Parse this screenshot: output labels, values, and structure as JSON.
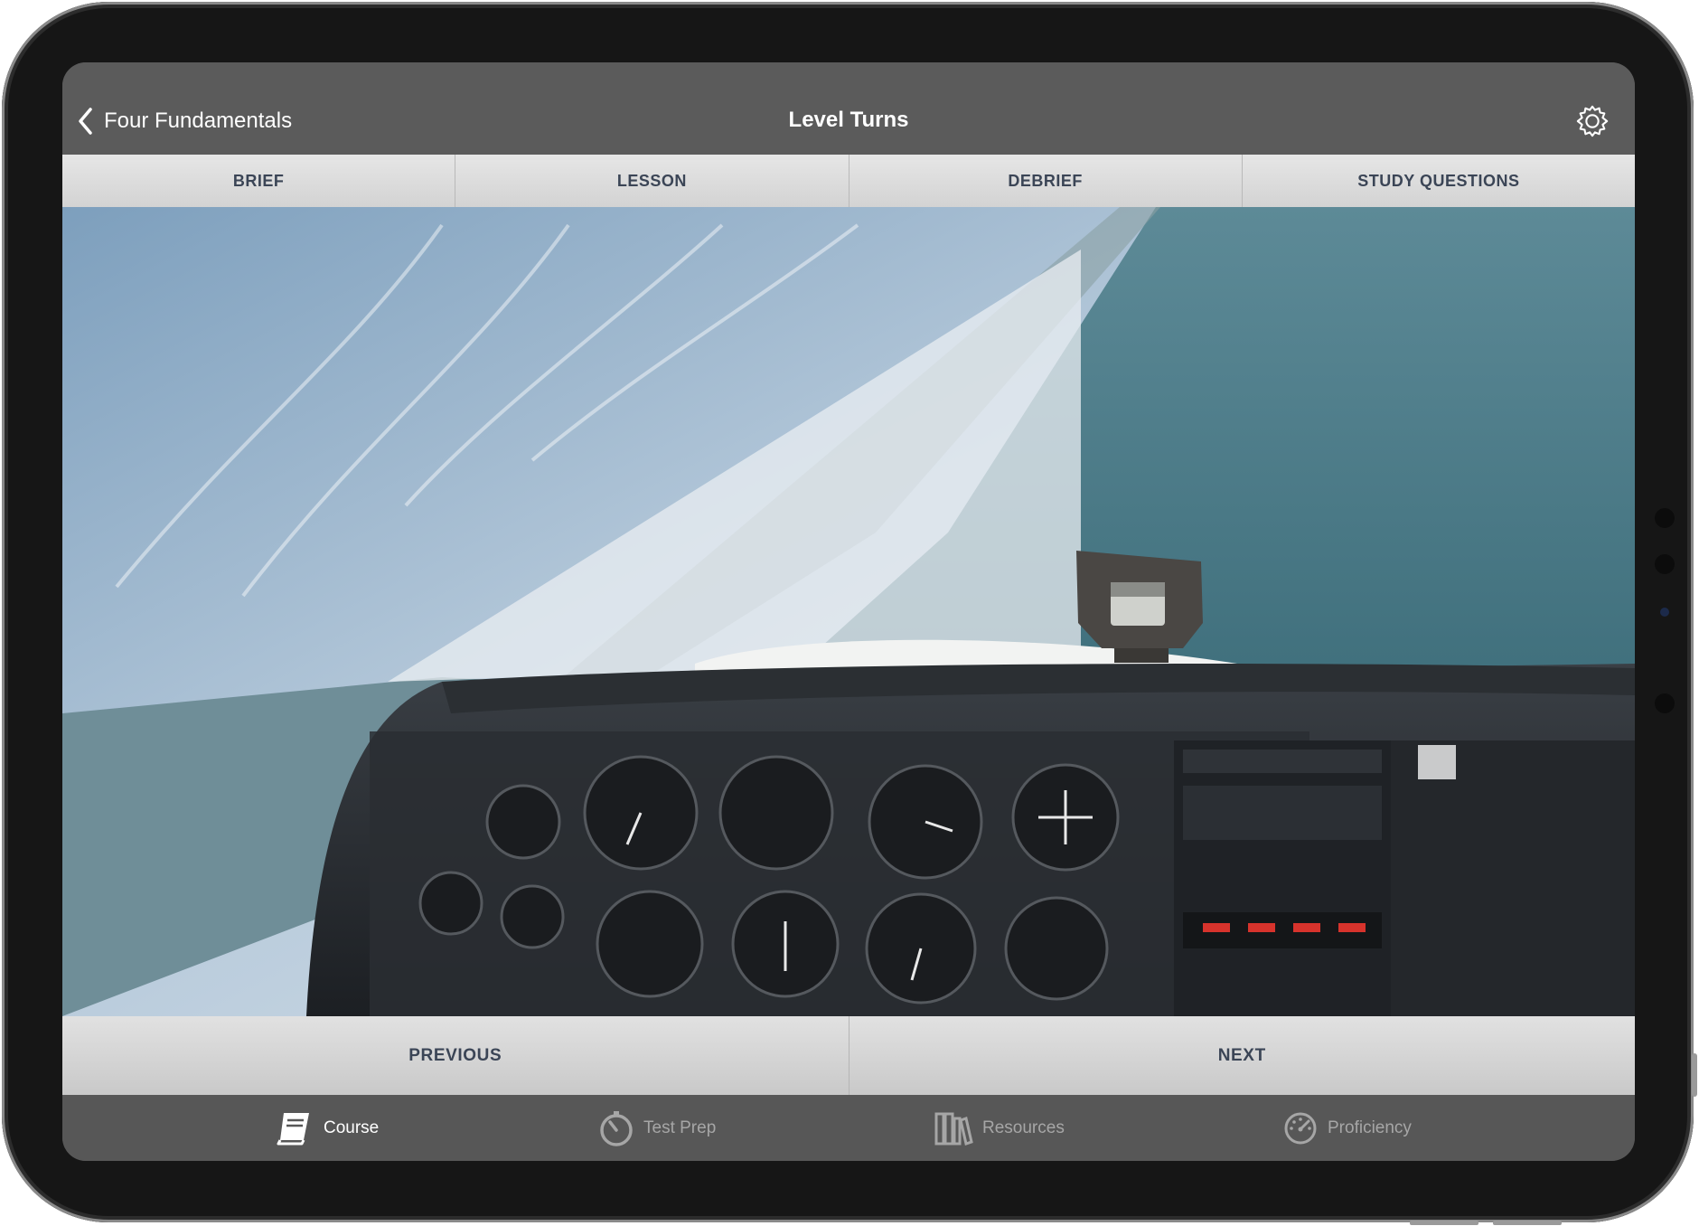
{
  "navbar": {
    "back_label": "Four Fundamentals",
    "title": "Level Turns"
  },
  "tabs": [
    {
      "label": "BRIEF"
    },
    {
      "label": "LESSON"
    },
    {
      "label": "DEBRIEF"
    },
    {
      "label": "STUDY QUESTIONS"
    }
  ],
  "video": {
    "content": "cockpit-view-banked-turn-over-coastline"
  },
  "pager": {
    "previous_label": "PREVIOUS",
    "next_label": "NEXT"
  },
  "tabbar": {
    "items": [
      {
        "label": "Course",
        "icon": "book-icon",
        "active": true
      },
      {
        "label": "Test Prep",
        "icon": "stopwatch-icon",
        "active": false
      },
      {
        "label": "Resources",
        "icon": "library-icon",
        "active": false
      },
      {
        "label": "Proficiency",
        "icon": "gauge-icon",
        "active": false
      }
    ]
  },
  "colors": {
    "navbar": "#5b5b5b",
    "tab_text": "#3b4556",
    "tabbar": "#575757",
    "active": "#ffffff",
    "inactive": "#a6a6a6"
  }
}
